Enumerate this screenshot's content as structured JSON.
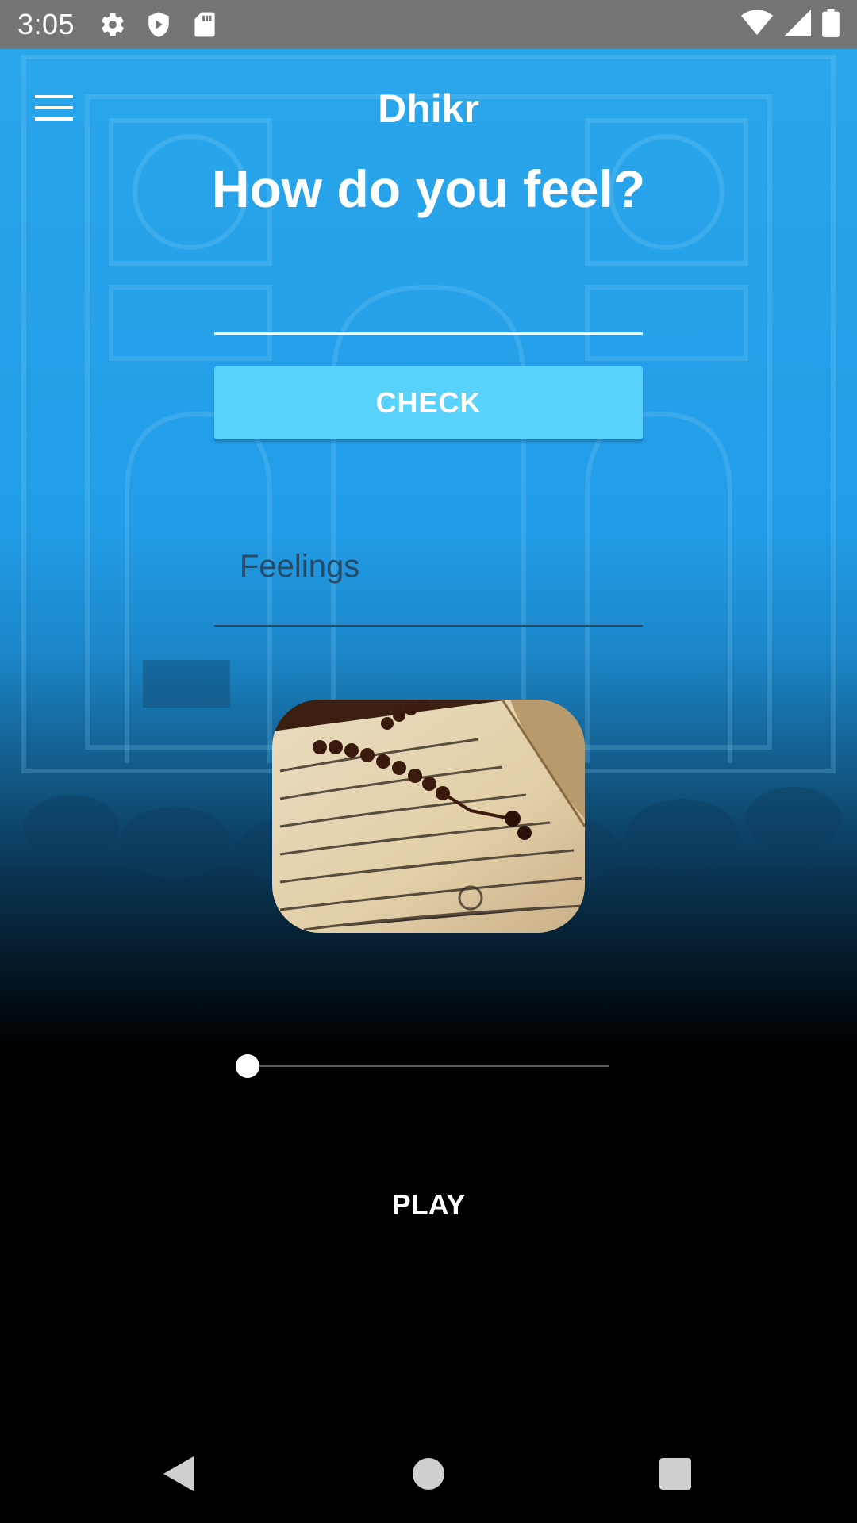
{
  "status_bar": {
    "time": "3:05",
    "left_icons": [
      "gear-icon",
      "shield-icon",
      "sd-card-icon"
    ],
    "right_icons": [
      "wifi-icon",
      "cell-signal-icon",
      "battery-icon"
    ]
  },
  "app": {
    "title": "Dhikr",
    "heading": "How do you feel?",
    "feel_input": {
      "value": "",
      "placeholder": ""
    },
    "check_label": "CHECK",
    "feelings_text": "Feelings",
    "image_subject": "quran-with-prayer-beads",
    "seek_position": 0,
    "play_label": "PLAY"
  },
  "nav_bar": [
    "back-icon",
    "home-icon",
    "recents-icon"
  ],
  "colors": {
    "primary_blue": "#2aa6ec",
    "check_button": "#58d2fb",
    "feelings_text": "#274a66",
    "status_bar": "#757575"
  }
}
